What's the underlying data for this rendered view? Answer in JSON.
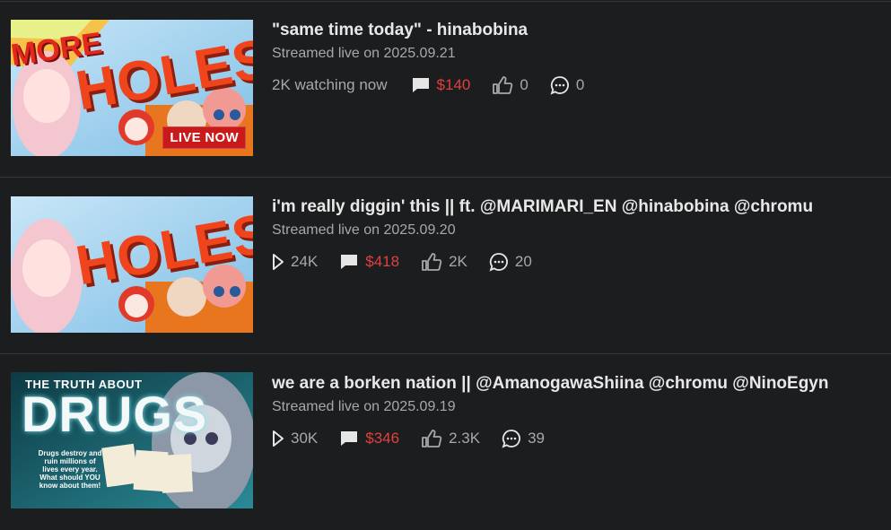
{
  "videos": [
    {
      "title": "\"same time today\" - hinabobina",
      "subtitle": "Streamed live on 2025.09.21",
      "watching": "2K watching now",
      "superchat": "$140",
      "likes": "0",
      "comments": "0",
      "thumb_text": "HOLES",
      "thumb_extra": "MORE",
      "live_badge": "LIVE NOW"
    },
    {
      "title": "i'm really diggin' this || ft. @MARIMARI_EN @hinabobina @chromu",
      "subtitle": "Streamed live on 2025.09.20",
      "views": "24K",
      "superchat": "$418",
      "likes": "2K",
      "comments": "20",
      "thumb_text": "HOLES"
    },
    {
      "title": "we are a borken nation || @AmanogawaShiina @chromu @NinoEgyn",
      "subtitle": "Streamed live on 2025.09.19",
      "views": "30K",
      "superchat": "$346",
      "likes": "2.3K",
      "comments": "39",
      "thumb_text": "DRUGS",
      "thumb_extra": "THE TRUTH ABOUT",
      "thumb_caption": "Drugs destroy and ruin millions of lives every year. What should YOU know about them!"
    }
  ],
  "colors": {
    "background": "#1c1d1f",
    "money": "#e0403e",
    "muted": "#a8a8a8",
    "live_badge": "#c81a1a"
  }
}
